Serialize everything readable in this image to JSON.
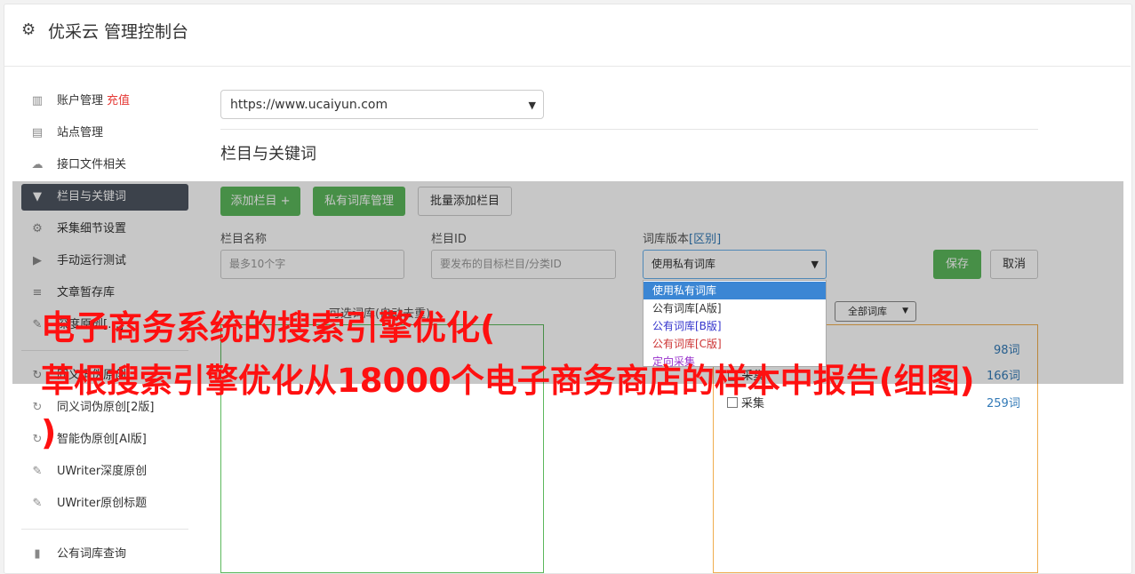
{
  "app": {
    "title": "优采云 管理控制台",
    "icon": "gear-icon"
  },
  "sidebar": {
    "items": [
      {
        "label": "账户管理",
        "badge": "充值",
        "icon": "bar-chart-icon",
        "glyph": "▥"
      },
      {
        "label": "站点管理",
        "icon": "server-icon",
        "glyph": "▤"
      },
      {
        "label": "接口文件相关",
        "icon": "cloud-upload-icon",
        "glyph": "☁"
      },
      {
        "label": "栏目与关键词",
        "icon": "filter-icon",
        "glyph": "▼"
      },
      {
        "label": "采集细节设置",
        "icon": "cogs-icon",
        "glyph": "⚙"
      },
      {
        "label": "手动运行测试",
        "icon": "play-circle-icon",
        "glyph": "▶"
      },
      {
        "label": "文章暂存库",
        "icon": "database-icon",
        "glyph": "≡"
      },
      {
        "label": "深度原创[…]",
        "icon": "edit-icon",
        "glyph": "✎"
      },
      {
        "label": "同义词伪原创",
        "icon": "refresh-icon",
        "glyph": "↻"
      },
      {
        "label": "同义词伪原创[2版]",
        "icon": "refresh-icon",
        "glyph": "↻"
      },
      {
        "label": "智能伪原创[AI版]",
        "icon": "refresh-icon",
        "glyph": "↻"
      },
      {
        "label": "UWriter深度原创",
        "icon": "edit-icon",
        "glyph": "✎"
      },
      {
        "label": "UWriter原创标题",
        "icon": "edit-icon",
        "glyph": "✎"
      },
      {
        "label": "公有词库查询",
        "icon": "book-icon",
        "glyph": "▮"
      }
    ]
  },
  "main": {
    "site_select": "https://www.ucaiyun.com",
    "section_title": "栏目与关键词",
    "buttons": {
      "add_column": "添加栏目 +",
      "private_lib": "私有词库管理",
      "batch_add": "批量添加栏目",
      "save": "保存",
      "cancel": "取消"
    },
    "form": {
      "name_label": "栏目名称",
      "name_placeholder": "最多10个字",
      "id_label": "栏目ID",
      "id_placeholder": "要发布的目标栏目/分类ID",
      "version_label": "词库版本",
      "version_link": "[区别]",
      "version_value": "使用私有词库"
    },
    "dropdown": {
      "options": [
        {
          "label": "使用私有词库",
          "color": "#ffffff"
        },
        {
          "label": "公有词库[A版]",
          "color": "#333333"
        },
        {
          "label": "公有词库[B版]",
          "color": "#3333cc"
        },
        {
          "label": "公有词库[C版]",
          "color": "#cc3333"
        },
        {
          "label": "定向采集",
          "color": "#9933cc"
        }
      ]
    },
    "available_label": "可选词库(自动去重)",
    "library_filter": "全部词库",
    "libraries": [
      {
        "label": "",
        "count": "98词"
      },
      {
        "label": "□ 采集",
        "count": "166词"
      },
      {
        "label": "采集",
        "count": "259词"
      }
    ]
  },
  "overlay_text": {
    "line1": "电子商务系统的搜索引擎优化(",
    "line2": "草根搜索引擎优化从18000个电子商务商店的样本中报告(组图)",
    "line3": ")"
  }
}
